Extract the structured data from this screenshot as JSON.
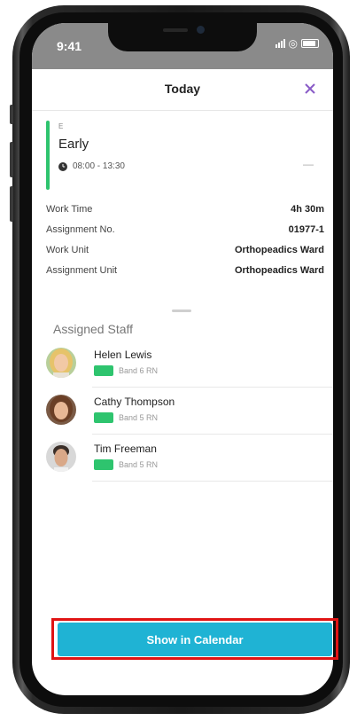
{
  "status_bar": {
    "time": "9:41"
  },
  "header": {
    "title": "Today",
    "close_icon": "close-icon"
  },
  "shift": {
    "code": "E",
    "name": "Early",
    "time_range": "08:00 - 13:30",
    "trailing": "—",
    "color": "#2ec46e"
  },
  "details": [
    {
      "label": "Work Time",
      "value": "4h 30m"
    },
    {
      "label": "Assignment No.",
      "value": "01977-1"
    },
    {
      "label": "Work Unit",
      "value": "Orthopeadics Ward"
    },
    {
      "label": "Assignment Unit",
      "value": "Orthopeadics Ward"
    }
  ],
  "assigned_staff": {
    "heading": "Assigned Staff",
    "people": [
      {
        "name": "Helen Lewis",
        "band": "Band 6 RN",
        "band_color": "#2ec46e"
      },
      {
        "name": "Cathy Thompson",
        "band": "Band 5 RN",
        "band_color": "#2ec46e"
      },
      {
        "name": "Tim Freeman",
        "band": "Band 5 RN",
        "band_color": "#2ec46e"
      }
    ]
  },
  "actions": {
    "show_in_calendar": "Show in Calendar"
  },
  "colors": {
    "accent": "#1fb3d4",
    "close_icon": "#8a5cc7",
    "highlight": "#e01414"
  }
}
